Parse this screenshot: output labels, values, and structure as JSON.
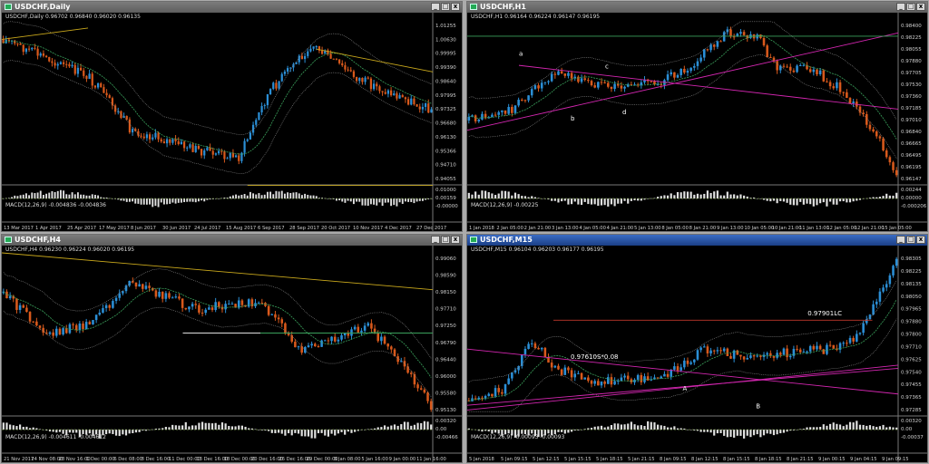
{
  "windows": [
    {
      "id": "daily",
      "title": "USDCHF,Daily",
      "active": false,
      "ohlc": "USDCHF,Daily  0.96702 0.96840 0.96020 0.96135",
      "macd_label": "MACD(12,26,9) -0.004836 -0.004836",
      "price_labels": [
        "1.01255",
        "1.00630",
        "0.99995",
        "0.99390",
        "0.98640",
        "0.97995",
        "0.97325",
        "0.96680",
        "0.96130",
        "0.95366",
        "0.94710",
        "0.94055"
      ],
      "macd_labels": [
        "0.01000",
        "0.00159",
        "-0.00000"
      ],
      "time_labels": [
        "13 Mar 2017",
        "1 Apr 2017",
        "25 Apr 2017",
        "17 May 2017",
        "8 Jun 2017",
        "30 Jun 2017",
        "24 Jul 2017",
        "15 Aug 2017",
        "6 Sep 2017",
        "28 Sep 2017",
        "20 Oct 2017",
        "10 Nov 2017",
        "4 Dec 2017",
        "27 Dec 2017"
      ],
      "annotations": []
    },
    {
      "id": "h1",
      "title": "USDCHF,H1",
      "active": false,
      "ohlc": "USDCHF,H1  0.96164 0.96224 0.96147 0.96195",
      "macd_label": "MACD(12,26,9) -0.00225",
      "price_labels": [
        "0.98400",
        "0.98225",
        "0.98055",
        "0.97880",
        "0.97705",
        "0.97530",
        "0.97360",
        "0.97185",
        "0.97010",
        "0.96840",
        "0.96665",
        "0.96495",
        "0.96195",
        "0.96147"
      ],
      "macd_labels": [
        "0.00244",
        "0.00000",
        "-0.000206"
      ],
      "time_labels": [
        "1 Jan 2018",
        "2 Jan 05:00",
        "2 Jan 21:00",
        "3 Jan 13:00",
        "4 Jan 05:00",
        "4 Jan 21:00",
        "5 Jan 13:00",
        "8 Jan 05:00",
        "8 Jan 21:00",
        "9 Jan 13:00",
        "10 Jan 05:00",
        "10 Jan 21:00",
        "11 Jan 13:00",
        "12 Jan 05:00",
        "12 Jan 21:00",
        "15 Jan 05:00"
      ],
      "annotations": [
        "a",
        "b",
        "c",
        "d"
      ]
    },
    {
      "id": "h4",
      "title": "USDCHF,H4",
      "active": false,
      "ohlc": "USDCHF,H4  0.96230 0.96224 0.96020 0.96195",
      "macd_label": "MACD(12,26,9) -0.004611 -0.004612",
      "price_labels": [
        "0.99060",
        "0.98590",
        "0.98150",
        "0.97710",
        "0.97250",
        "0.96790",
        "0.96440",
        "0.96000",
        "0.95580",
        "0.95130"
      ],
      "macd_labels": [
        "0.00320",
        "0.00",
        "-0.00466"
      ],
      "time_labels": [
        "21 Nov 2017",
        "24 Nov 08:00",
        "28 Nov 16:00",
        "1 Dec 00:00",
        "6 Dec 08:00",
        "8 Dec 16:00",
        "11 Dec 00:00",
        "13 Dec 16:00",
        "18 Dec 00:00",
        "20 Dec 16:00",
        "26 Dec 16:00",
        "29 Dec 00:00",
        "3 Jan 08:00",
        "5 Jan 16:00",
        "9 Jan 00:00",
        "11 Jan 16:00"
      ],
      "annotations": []
    },
    {
      "id": "m15",
      "title": "USDCHF,M15",
      "active": true,
      "ohlc": "USDCHF,M15  0.96104 0.96203 0.96177 0.96195",
      "macd_label": "MACD(12,26,9) -0.00093 -0.00093",
      "price_labels": [
        "0.98305",
        "0.98225",
        "0.98135",
        "0.98050",
        "0.97965",
        "0.97880",
        "0.97800",
        "0.97710",
        "0.97625",
        "0.97540",
        "0.97455",
        "0.97365",
        "0.97285"
      ],
      "macd_labels": [
        "0.00320",
        "0.00",
        "-0.00037"
      ],
      "time_labels": [
        "5 Jan 2018",
        "5 Jan 09:15",
        "5 Jan 12:15",
        "5 Jan 15:15",
        "5 Jan 18:15",
        "5 Jan 21:15",
        "8 Jan 09:15",
        "8 Jan 12:15",
        "8 Jan 15:15",
        "8 Jan 18:15",
        "8 Jan 21:15",
        "9 Jan 00:15",
        "9 Jan 04:15",
        "9 Jan 09:15"
      ],
      "annotations": [
        "0.97610S*0.08",
        "0.97901LC",
        "A",
        "B"
      ]
    }
  ],
  "colors": {
    "bull": "#2b8fd6",
    "bear": "#d8591c",
    "sma_green": "#3aa05b",
    "bollinger": "#8a8a8a",
    "trend_magenta": "#d326b0",
    "trend_yellow": "#c9a81c",
    "macd": "#e0e0e0",
    "grid_price": "#9a9a9a"
  }
}
